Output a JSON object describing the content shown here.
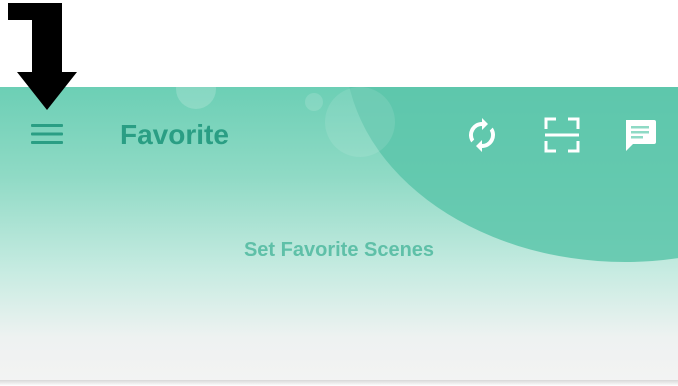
{
  "header": {
    "title": "Favorite"
  },
  "toolbar": {
    "menu_icon": "hamburger-menu-icon",
    "actions": [
      {
        "name": "sync",
        "icon": "sync-icon"
      },
      {
        "name": "scan",
        "icon": "scan-icon"
      },
      {
        "name": "messages",
        "icon": "message-icon"
      }
    ]
  },
  "main": {
    "empty_text": "Set Favorite Scenes"
  },
  "colors": {
    "accent": "#2a9e84",
    "header_gradient_top": "#6ccfb5",
    "background_bottom": "#f3f3f3",
    "empty_text_color": "#5fc0a8",
    "annotation_arrow": "#000000"
  }
}
